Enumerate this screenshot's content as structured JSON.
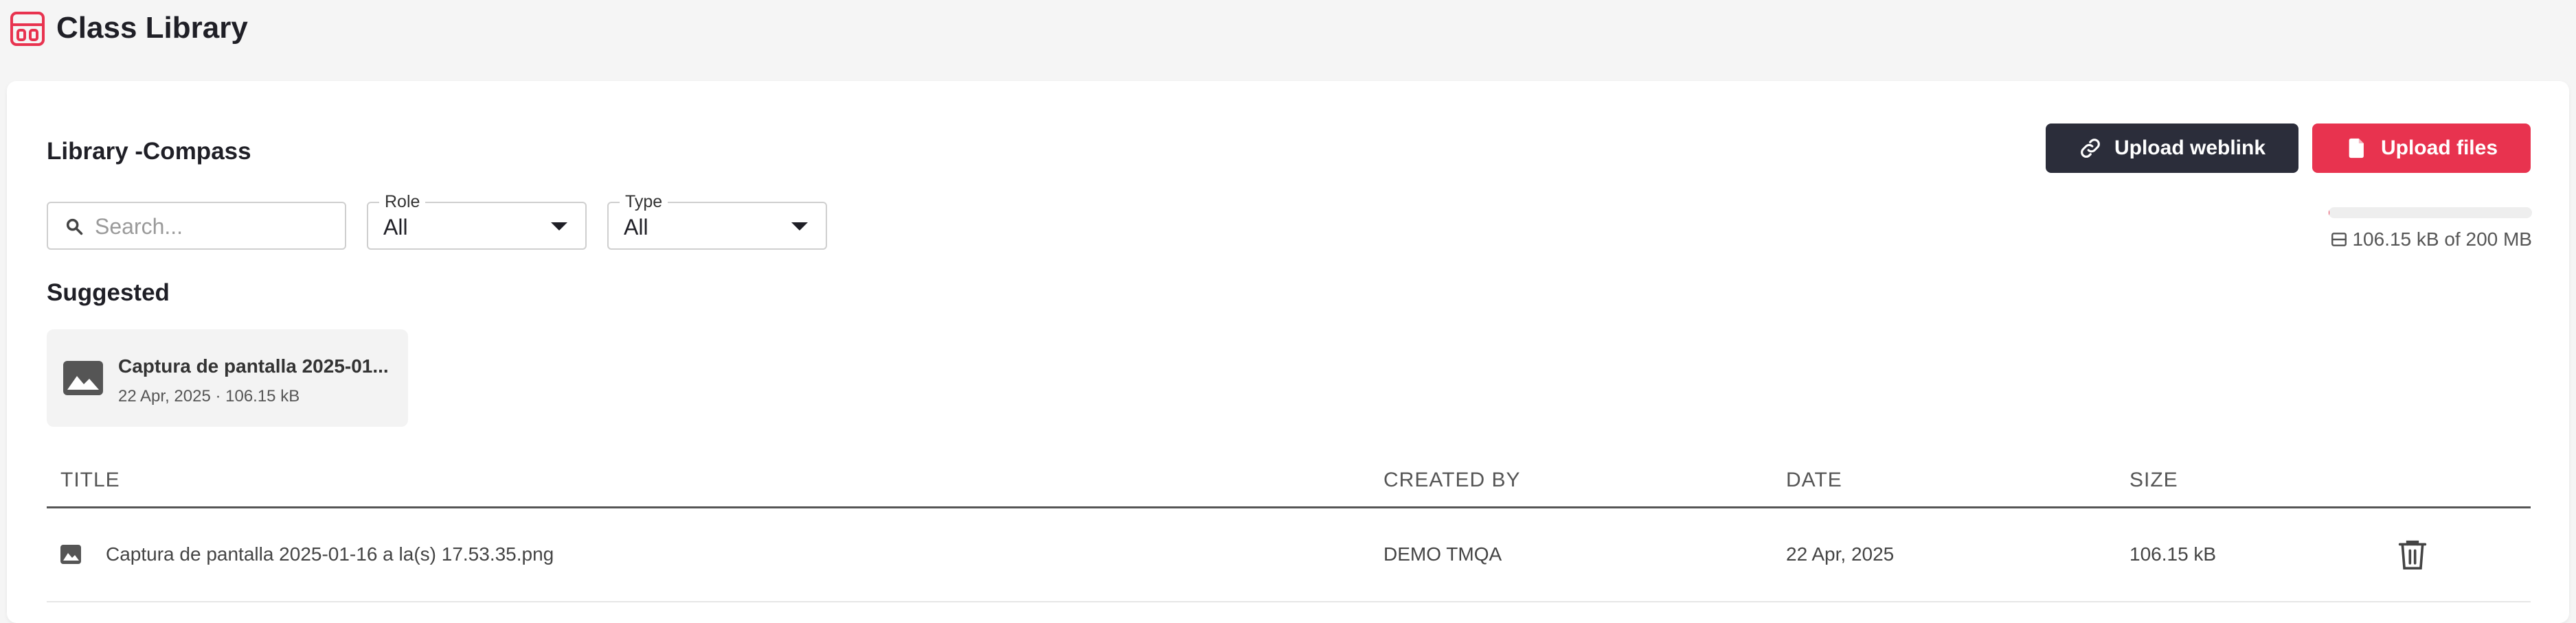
{
  "app": {
    "title": "Class Library",
    "icon": "layout-icon",
    "accent": "#e8334f"
  },
  "library": {
    "title": "Library -Compass",
    "upload_weblink_label": "Upload weblink",
    "upload_files_label": "Upload files",
    "storage": {
      "used_fraction": 0.0005,
      "text": "106.15 kB of 200 MB"
    }
  },
  "filters": {
    "search_placeholder": "Search...",
    "role": {
      "label": "Role",
      "value": "All"
    },
    "type": {
      "label": "Type",
      "value": "All"
    }
  },
  "suggested": {
    "title": "Suggested",
    "items": [
      {
        "name": "Captura de pantalla 2025-01...",
        "meta": "22 Apr, 2025 · 106.15 kB",
        "icon": "image-icon"
      }
    ]
  },
  "table": {
    "columns": {
      "title": "TITLE",
      "created_by": "CREATED BY",
      "date": "DATE",
      "size": "SIZE"
    },
    "rows": [
      {
        "title": "Captura de pantalla 2025-01-16 a la(s) 17.53.35.png",
        "created_by": "DEMO TMQA",
        "date": "22 Apr, 2025",
        "size": "106.15 kB"
      }
    ]
  }
}
